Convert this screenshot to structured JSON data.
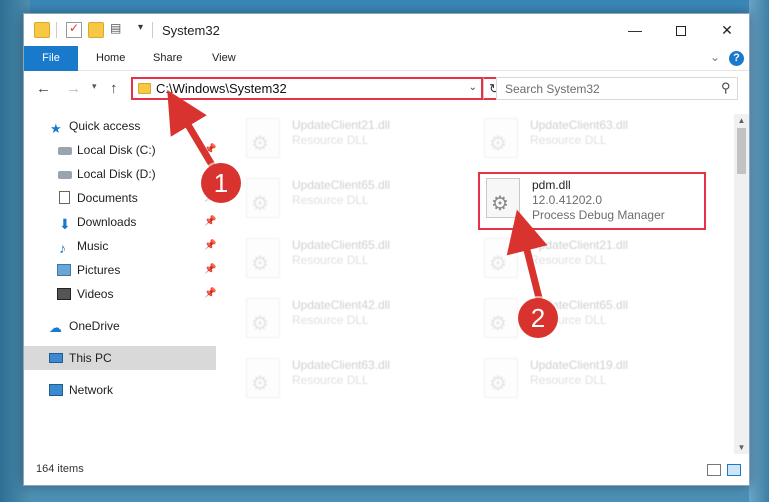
{
  "window": {
    "title": "System32",
    "controls": {
      "minimize": "—",
      "close": "✕"
    }
  },
  "ribbon": {
    "tabs": [
      "File",
      "Home",
      "Share",
      "View"
    ]
  },
  "navigation": {
    "address": "C:\\Windows\\System32",
    "search_placeholder": "Search System32"
  },
  "sidebar": {
    "items": [
      {
        "label": "Quick access",
        "icon": "star-icon"
      },
      {
        "label": "Local Disk (C:)",
        "icon": "drive-icon"
      },
      {
        "label": "Local Disk (D:)",
        "icon": "drive-icon"
      },
      {
        "label": "Documents",
        "icon": "documents-icon"
      },
      {
        "label": "Downloads",
        "icon": "downloads-icon"
      },
      {
        "label": "Music",
        "icon": "music-icon"
      },
      {
        "label": "Pictures",
        "icon": "pictures-icon"
      },
      {
        "label": "Videos",
        "icon": "videos-icon"
      },
      {
        "label": "OneDrive",
        "icon": "cloud-icon"
      },
      {
        "label": "This PC",
        "icon": "computer-icon",
        "selected": true
      },
      {
        "label": "Network",
        "icon": "network-icon"
      }
    ]
  },
  "files": [
    {
      "name": "UpdateClient21.dll",
      "sub1": "Resource DLL",
      "sub2": ""
    },
    {
      "name": "UpdateClient63.dll",
      "sub1": "Resource DLL",
      "sub2": ""
    },
    {
      "name": "UpdateClient65.dll",
      "sub1": "Resource DLL",
      "sub2": ""
    },
    {
      "name": "pdm.dll",
      "sub1": "12.0.41202.0",
      "sub2": "Process Debug Manager"
    },
    {
      "name": "UpdateClient65.dll",
      "sub1": "Resource DLL",
      "sub2": ""
    },
    {
      "name": "UpdateClient21.dll",
      "sub1": "Resource DLL",
      "sub2": ""
    },
    {
      "name": "UpdateClient42.dll",
      "sub1": "Resource DLL",
      "sub2": ""
    },
    {
      "name": "UpdateClient65.dll",
      "sub1": "Resource DLL",
      "sub2": ""
    },
    {
      "name": "UpdateClient63.dll",
      "sub1": "Resource DLL",
      "sub2": ""
    },
    {
      "name": "UpdateClient19.dll",
      "sub1": "Resource DLL",
      "sub2": ""
    }
  ],
  "status": {
    "item_count": "164 items"
  },
  "annotations": {
    "step1": "1",
    "step2": "2",
    "color": "#d9332f"
  }
}
